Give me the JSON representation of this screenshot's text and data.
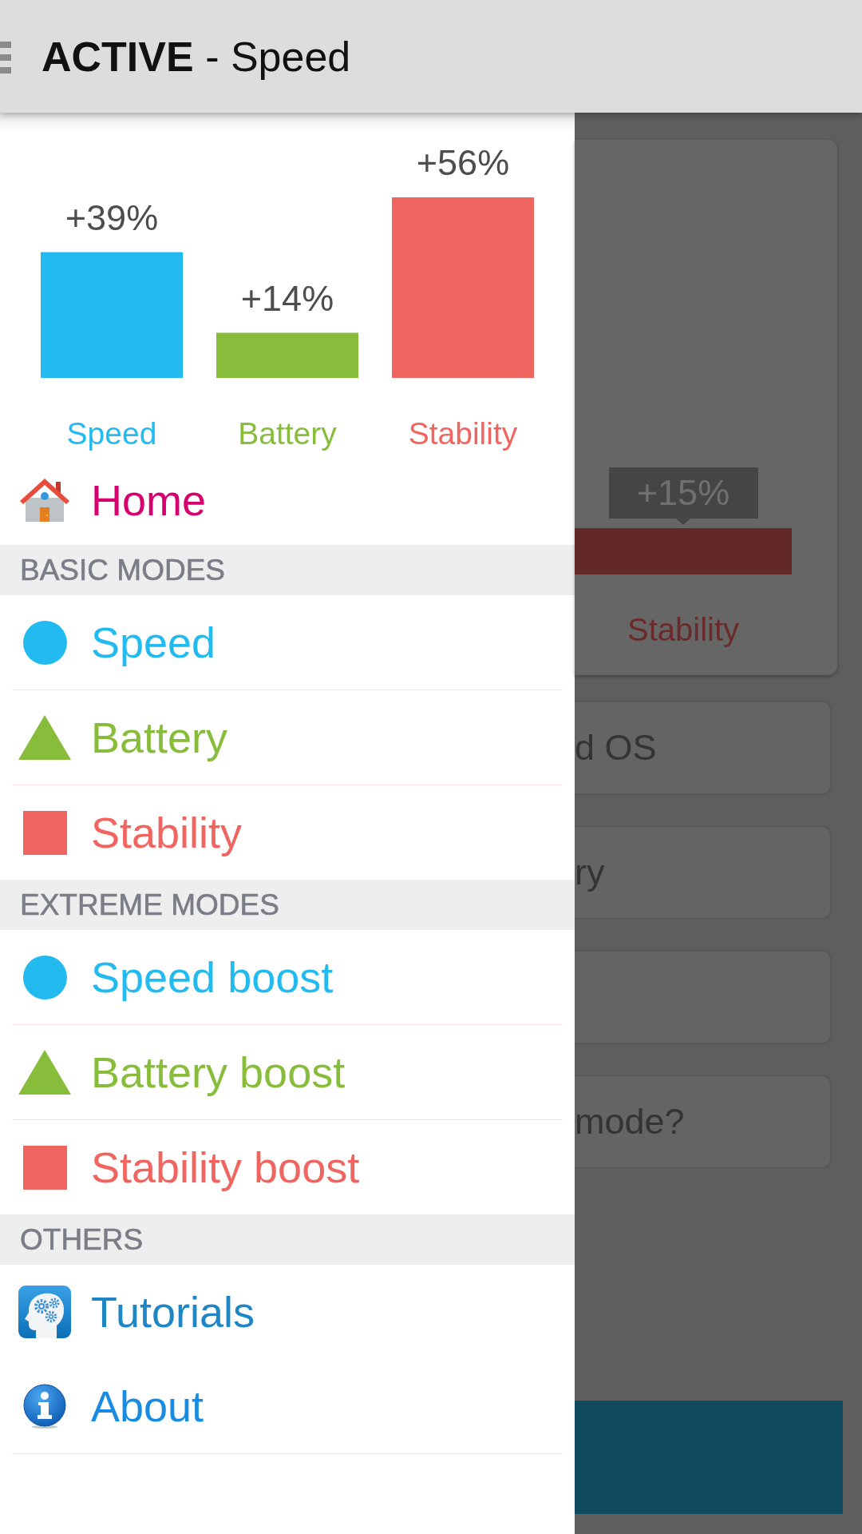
{
  "app_bar": {
    "title": "**ACTIVE** - Speed"
  },
  "drawer": {
    "chart_data": {
      "type": "bar",
      "categories": [
        "Speed",
        "Battery",
        "Stability"
      ],
      "values": [
        39,
        14,
        56
      ],
      "value_labels": [
        "+39%",
        "+14%",
        "+56%"
      ],
      "colors": [
        "#23bbef",
        "#88bd3b",
        "#f16560"
      ]
    },
    "menu": [
      {
        "kind": "house",
        "label": "Home",
        "color": "#d7006f",
        "divider_below": false
      },
      {
        "kind": "header",
        "label": "BASIC MODES"
      },
      {
        "kind": "circle",
        "label": "Speed",
        "color": "#23bbef",
        "divider_below": true
      },
      {
        "kind": "triangle",
        "label": "Battery",
        "color": "#88bd3b",
        "divider_below": true
      },
      {
        "kind": "square",
        "label": "Stability",
        "color": "#f16560",
        "divider_below": false
      },
      {
        "kind": "header",
        "label": "EXTREME MODES"
      },
      {
        "kind": "circle",
        "label": "Speed boost",
        "color": "#23bbef",
        "divider_below": true
      },
      {
        "kind": "triangle",
        "label": "Battery boost",
        "color": "#88bd3b",
        "divider_below": true
      },
      {
        "kind": "square",
        "label": "Stability boost",
        "color": "#f16560",
        "divider_below": false
      },
      {
        "kind": "header",
        "label": "OTHERS"
      },
      {
        "kind": "head",
        "label": "Tutorials",
        "color": "#1f86c6",
        "divider_below": false
      },
      {
        "kind": "info",
        "label": "About",
        "color": "#188be2",
        "divider_below": true
      }
    ]
  },
  "background": {
    "chart_card": {
      "value_label": "+15%",
      "category": "Stability"
    },
    "cards": [
      {
        "kind": "text",
        "text": "d OS"
      },
      {
        "kind": "text",
        "text": "ry"
      },
      {
        "kind": "blank"
      },
      {
        "kind": "text",
        "text": "mode?"
      }
    ]
  }
}
